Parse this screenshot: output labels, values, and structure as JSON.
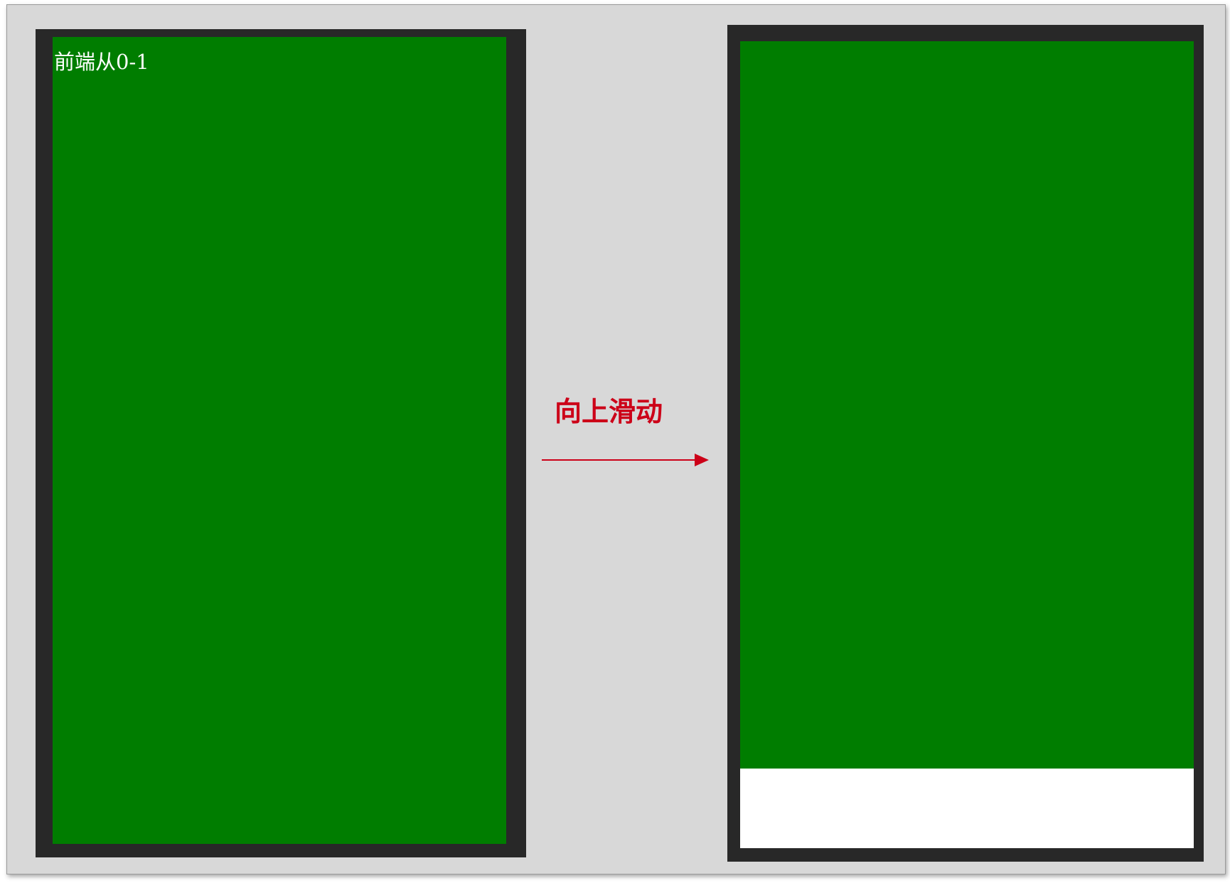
{
  "diagram": {
    "left_phone": {
      "page_text": "前端从0-1",
      "screen_color": "#007d00"
    },
    "transition": {
      "label": "向上滑动",
      "color": "#cc0018"
    },
    "right_phone": {
      "screen_color": "#007d00",
      "revealed_area_color": "#ffffff"
    },
    "frame_color": "#282828",
    "background_color": "#d8d8d8"
  }
}
